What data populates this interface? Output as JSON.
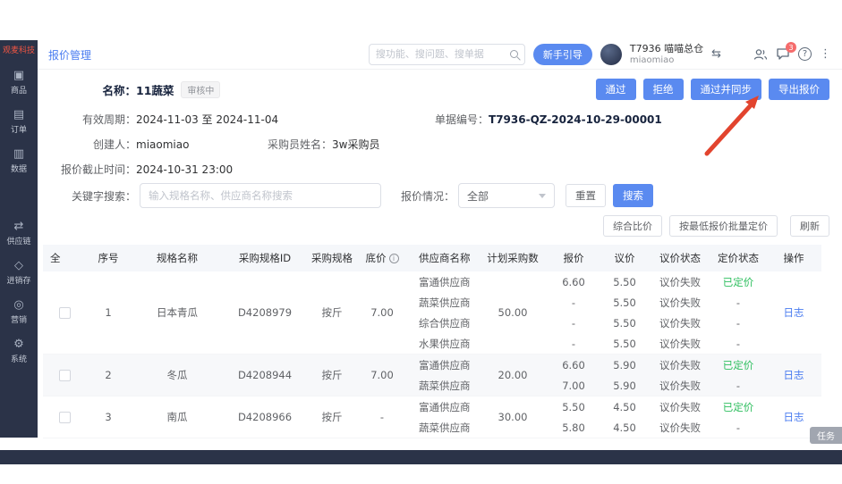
{
  "colors": {
    "accent": "#5a8af0",
    "sidebar": "#2b3348",
    "link": "#4a7cf0",
    "green": "#2fbf5f",
    "arrow_red": "#e2442e"
  },
  "sidebar": {
    "logo": "观麦科技",
    "items": [
      {
        "label": "商品",
        "icon": "box-icon",
        "glyph": "▣"
      },
      {
        "label": "订单",
        "icon": "list-icon",
        "glyph": "▤"
      },
      {
        "label": "数据",
        "icon": "chart-icon",
        "glyph": "▥"
      },
      {
        "label": "供应链",
        "icon": "sync-icon",
        "glyph": "⇄"
      },
      {
        "label": "进销存",
        "icon": "inventory-icon",
        "glyph": "◇"
      },
      {
        "label": "营销",
        "icon": "marketing-icon",
        "glyph": "◎"
      },
      {
        "label": "系统",
        "icon": "gear-icon",
        "glyph": "⚙"
      }
    ]
  },
  "topbar": {
    "breadcrumb": "报价管理",
    "search_placeholder": "搜功能、搜问题、搜单据",
    "guide_button": "新手引导",
    "account_name": "T7936 喵喵总仓",
    "account_sub": "miaomiao",
    "switch_glyph": "⇆",
    "badge_count": "3",
    "help": "?",
    "menu_glyph": "⋮"
  },
  "detail": {
    "name_label": "名称：",
    "name": "11蔬菜",
    "status_tag": "审核中",
    "approve": "通过",
    "reject": "拒绝",
    "approve_sync": "通过并同步",
    "export": "导出报价",
    "period_label": "有效周期：",
    "period": "2024-11-03 至 2024-11-04",
    "doc_label": "单据编号：",
    "doc_no": "T7936-QZ-2024-10-29-00001",
    "creator_label": "创建人：",
    "creator": "miaomiao",
    "buyer_label": "采购员姓名：",
    "buyer": "3w采购员",
    "deadline_label": "报价截止时间：",
    "deadline": "2024-10-31 23:00"
  },
  "filter": {
    "keyword_label": "关键字搜索：",
    "keyword_placeholder": "输入规格名称、供应商名称搜索",
    "status_label": "报价情况：",
    "status_value": "全部",
    "reset": "重置",
    "search": "搜索"
  },
  "toolbar": {
    "compare": "综合比价",
    "batch": "按最低报价批量定价",
    "refresh": "刷新"
  },
  "table": {
    "headers": {
      "sel": "全",
      "no": "序号",
      "spec": "规格名称",
      "spec_id": "采购规格ID",
      "unit": "采购规格",
      "base": "底价",
      "base_info": "i",
      "supplier": "供应商名称",
      "qty": "计划采购数",
      "quote": "报价",
      "nego": "议价",
      "nego_status": "议价状态",
      "price_status": "定价状态",
      "op": "操作"
    },
    "rows": [
      {
        "no": "1",
        "spec": "日本青瓜",
        "spec_id": "D4208979",
        "unit": "按斤",
        "base": "7.00",
        "qty": "50.00",
        "log": "日志",
        "lines": [
          {
            "supplier": "富通供应商",
            "quote": "6.60",
            "nego": "5.50",
            "nego_status": "议价失败",
            "price_status": "已定价"
          },
          {
            "supplier": "蔬菜供应商",
            "quote": "-",
            "nego": "5.50",
            "nego_status": "议价失败",
            "price_status": "-"
          },
          {
            "supplier": "综合供应商",
            "quote": "-",
            "nego": "5.50",
            "nego_status": "议价失败",
            "price_status": "-"
          },
          {
            "supplier": "水果供应商",
            "quote": "-",
            "nego": "5.50",
            "nego_status": "议价失败",
            "price_status": "-"
          }
        ]
      },
      {
        "no": "2",
        "spec": "冬瓜",
        "spec_id": "D4208944",
        "unit": "按斤",
        "base": "7.00",
        "qty": "20.00",
        "log": "日志",
        "lines": [
          {
            "supplier": "富通供应商",
            "quote": "6.60",
            "nego": "5.90",
            "nego_status": "议价失败",
            "price_status": "已定价"
          },
          {
            "supplier": "蔬菜供应商",
            "quote": "7.00",
            "nego": "5.90",
            "nego_status": "议价失败",
            "price_status": "-"
          }
        ]
      },
      {
        "no": "3",
        "spec": "南瓜",
        "spec_id": "D4208966",
        "unit": "按斤",
        "base": "-",
        "qty": "30.00",
        "log": "日志",
        "lines": [
          {
            "supplier": "富通供应商",
            "quote": "5.50",
            "nego": "4.50",
            "nego_status": "议价失败",
            "price_status": "已定价"
          },
          {
            "supplier": "蔬菜供应商",
            "quote": "5.80",
            "nego": "4.50",
            "nego_status": "议价失败",
            "price_status": "-"
          }
        ]
      }
    ]
  },
  "task_tab": "任务"
}
